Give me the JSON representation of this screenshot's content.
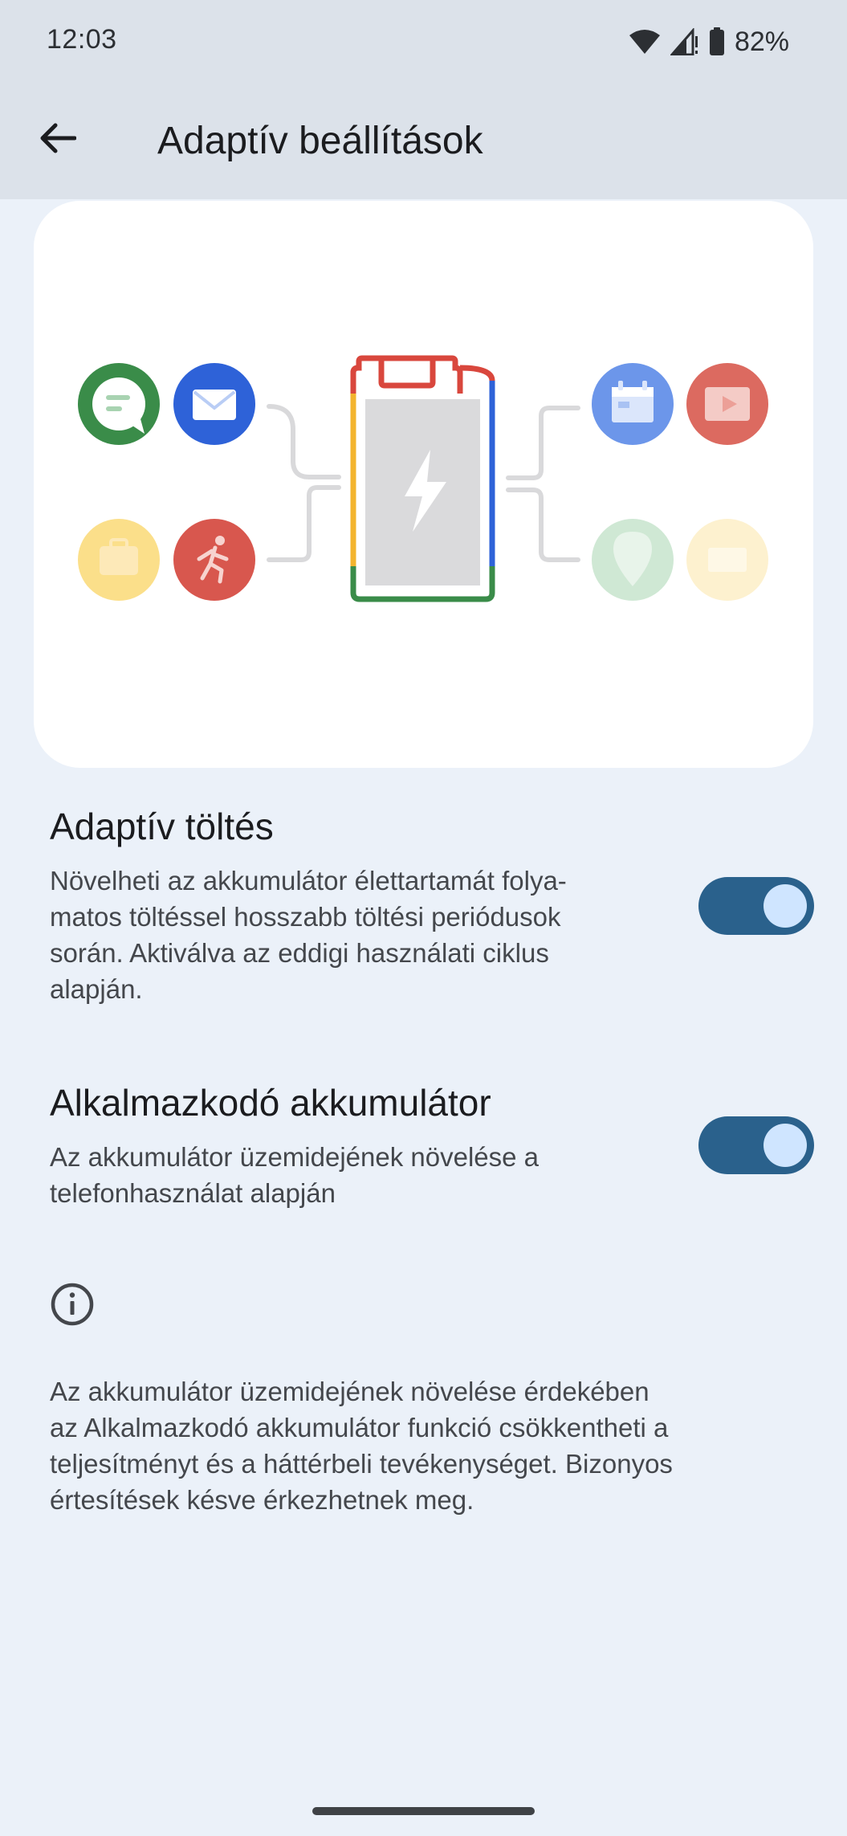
{
  "status_bar": {
    "time": "12:03",
    "battery_percent": "82%",
    "icons": [
      "wifi-icon",
      "cell-signal-icon",
      "battery-icon"
    ]
  },
  "app_bar": {
    "back_icon": "arrow-back-icon",
    "title": "Adaptív beállítások"
  },
  "illustration": {
    "left_apps": [
      "message-app-icon",
      "mail-app-icon",
      "briefcase-app-icon",
      "fitness-app-icon"
    ],
    "right_apps": [
      "calendar-app-icon",
      "video-app-icon",
      "maps-app-icon",
      "tv-app-icon"
    ],
    "center": "charging-battery-icon"
  },
  "settings": [
    {
      "title": "Adaptív töltés",
      "description_lines": [
        "Növelheti az akkumulátor élettartamát folya-",
        "matos töltéssel hosszabb töltési periódusok",
        "során. Aktiválva az eddigi használati ciklus",
        "alapján."
      ],
      "enabled": true
    },
    {
      "title": "Alkalmazkodó akkumulátor",
      "description_lines": [
        "Az akkumulátor üzemidejének növelése a",
        "telefonhasználat alapján"
      ],
      "enabled": true
    }
  ],
  "footer": {
    "icon": "info-icon",
    "lines": [
      "Az akkumulátor üzemidejének növelése érdekében",
      "az Alkalmazkodó akkumulátor funkció csökkentheti a",
      "teljesítményt és a háttérbeli tevékenységet. Bizonyos",
      "értesítések késve érkezhetnek meg."
    ]
  },
  "colors": {
    "accent_toggle": "#2a618c",
    "toggle_knob": "#cfe5ff",
    "background": "#ebf1f9",
    "top_bar": "#dce2ea"
  }
}
